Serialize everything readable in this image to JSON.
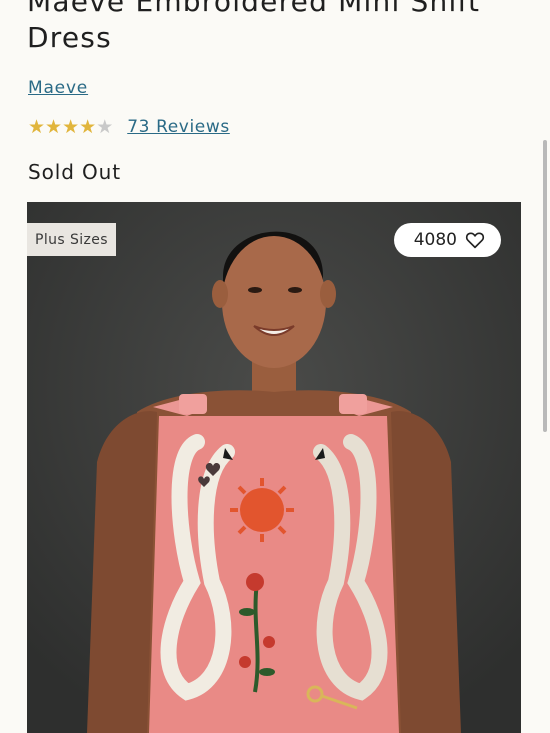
{
  "product": {
    "title": "Maeve Embroidered Mini Shift Dress",
    "brand": "Maeve",
    "rating": 4,
    "rating_max": 5,
    "reviews_label": "73 Reviews",
    "status": "Sold Out"
  },
  "image": {
    "badge": "Plus Sizes",
    "favorite_count": "4080",
    "favorite_icon": "heart-icon",
    "background_color": "#3a3b3a"
  },
  "colors": {
    "link": "#2a6a86",
    "star": "#e1b53c"
  }
}
